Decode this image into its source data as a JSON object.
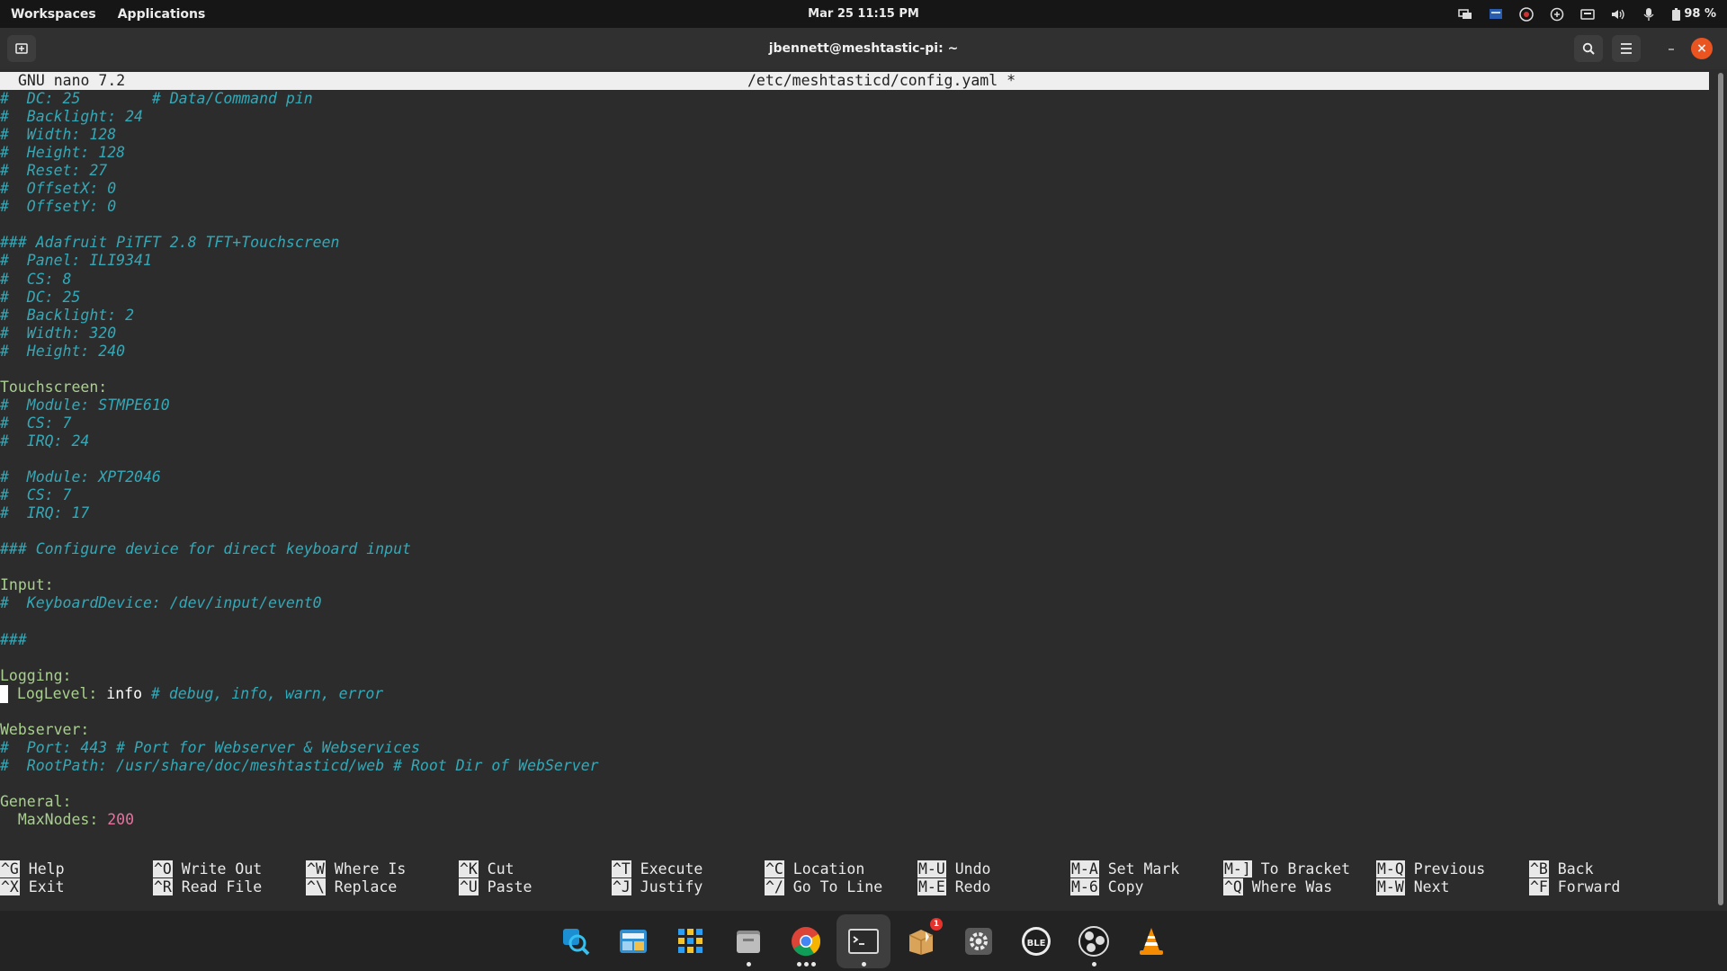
{
  "topbar": {
    "workspaces": "Workspaces",
    "applications": "Applications",
    "clock": "Mar 25  11:15 PM",
    "battery": "98 %"
  },
  "window": {
    "title": "jbennett@meshtastic-pi: ~",
    "new_tab_icon": "new-tab-icon",
    "search_icon": "search-icon",
    "menu_icon": "hamburger-menu-icon",
    "minimize_label": "–",
    "close_label": "×"
  },
  "nano": {
    "version": "GNU nano 7.2",
    "file": "/etc/meshtasticd/config.yaml *"
  },
  "editor_lines": [
    {
      "row": 0,
      "segs": [
        [
          "cm",
          "#  DC: 25        # Data/Command pin"
        ]
      ]
    },
    {
      "row": 1,
      "segs": [
        [
          "cm",
          "#  Backlight: 24"
        ]
      ]
    },
    {
      "row": 2,
      "segs": [
        [
          "cm",
          "#  Width: 128"
        ]
      ]
    },
    {
      "row": 3,
      "segs": [
        [
          "cm",
          "#  Height: 128"
        ]
      ]
    },
    {
      "row": 4,
      "segs": [
        [
          "cm",
          "#  Reset: 27"
        ]
      ]
    },
    {
      "row": 5,
      "segs": [
        [
          "cm",
          "#  OffsetX: 0"
        ]
      ]
    },
    {
      "row": 6,
      "segs": [
        [
          "cm",
          "#  OffsetY: 0"
        ]
      ]
    },
    {
      "row": 8,
      "segs": [
        [
          "cm",
          "### Adafruit PiTFT 2.8 TFT+Touchscreen"
        ]
      ]
    },
    {
      "row": 9,
      "segs": [
        [
          "cm",
          "#  Panel: ILI9341"
        ]
      ]
    },
    {
      "row": 10,
      "segs": [
        [
          "cm",
          "#  CS: 8"
        ]
      ]
    },
    {
      "row": 11,
      "segs": [
        [
          "cm",
          "#  DC: 25"
        ]
      ]
    },
    {
      "row": 12,
      "segs": [
        [
          "cm",
          "#  Backlight: 2"
        ]
      ]
    },
    {
      "row": 13,
      "segs": [
        [
          "cm",
          "#  Width: 320"
        ]
      ]
    },
    {
      "row": 14,
      "segs": [
        [
          "cm",
          "#  Height: 240"
        ]
      ]
    },
    {
      "row": 16,
      "segs": [
        [
          "ky",
          "Touchscreen:"
        ]
      ]
    },
    {
      "row": 17,
      "segs": [
        [
          "cm",
          "#  Module: STMPE610"
        ]
      ]
    },
    {
      "row": 18,
      "segs": [
        [
          "cm",
          "#  CS: 7"
        ]
      ]
    },
    {
      "row": 19,
      "segs": [
        [
          "cm",
          "#  IRQ: 24"
        ]
      ]
    },
    {
      "row": 21,
      "segs": [
        [
          "cm",
          "#  Module: XPT2046"
        ]
      ]
    },
    {
      "row": 22,
      "segs": [
        [
          "cm",
          "#  CS: 7"
        ]
      ]
    },
    {
      "row": 23,
      "segs": [
        [
          "cm",
          "#  IRQ: 17"
        ]
      ]
    },
    {
      "row": 25,
      "segs": [
        [
          "cm",
          "### Configure device for direct keyboard input"
        ]
      ]
    },
    {
      "row": 27,
      "segs": [
        [
          "ky",
          "Input:"
        ]
      ]
    },
    {
      "row": 28,
      "segs": [
        [
          "cm",
          "#  KeyboardDevice: /dev/input/event0"
        ]
      ]
    },
    {
      "row": 30,
      "segs": [
        [
          "cm",
          "###"
        ]
      ]
    },
    {
      "row": 32,
      "segs": [
        [
          "ky",
          "Logging:"
        ]
      ]
    },
    {
      "row": 33,
      "segs": [
        [
          "cursor",
          ""
        ],
        [
          "ky",
          " LogLevel: "
        ],
        [
          "tx",
          "info "
        ],
        [
          "cm",
          "# debug, info, warn, error"
        ]
      ]
    },
    {
      "row": 35,
      "segs": [
        [
          "ky",
          "Webserver:"
        ]
      ]
    },
    {
      "row": 36,
      "segs": [
        [
          "cm",
          "#  Port: 443 # Port for Webserver & Webservices"
        ]
      ]
    },
    {
      "row": 37,
      "segs": [
        [
          "cm",
          "#  RootPath: /usr/share/doc/meshtasticd/web # Root Dir of WebServer"
        ]
      ]
    },
    {
      "row": 39,
      "segs": [
        [
          "ky",
          "General:"
        ]
      ]
    },
    {
      "row": 40,
      "segs": [
        [
          "ky",
          "  MaxNodes: "
        ],
        [
          "nm",
          "200"
        ]
      ]
    }
  ],
  "shortcuts": [
    [
      {
        "key": "^G",
        "label": "Help"
      },
      {
        "key": "^X",
        "label": "Exit"
      }
    ],
    [
      {
        "key": "^O",
        "label": "Write Out"
      },
      {
        "key": "^R",
        "label": "Read File"
      }
    ],
    [
      {
        "key": "^W",
        "label": "Where Is"
      },
      {
        "key": "^\\",
        "label": "Replace"
      }
    ],
    [
      {
        "key": "^K",
        "label": "Cut"
      },
      {
        "key": "^U",
        "label": "Paste"
      }
    ],
    [
      {
        "key": "^T",
        "label": "Execute"
      },
      {
        "key": "^J",
        "label": "Justify"
      }
    ],
    [
      {
        "key": "^C",
        "label": "Location"
      },
      {
        "key": "^/",
        "label": "Go To Line"
      }
    ],
    [
      {
        "key": "M-U",
        "label": "Undo"
      },
      {
        "key": "M-E",
        "label": "Redo"
      }
    ],
    [
      {
        "key": "M-A",
        "label": "Set Mark"
      },
      {
        "key": "M-6",
        "label": "Copy"
      }
    ],
    [
      {
        "key": "M-]",
        "label": "To Bracket"
      },
      {
        "key": "^Q",
        "label": "Where Was"
      }
    ],
    [
      {
        "key": "M-Q",
        "label": "Previous"
      },
      {
        "key": "M-W",
        "label": "Next"
      }
    ],
    [
      {
        "key": "^B",
        "label": "Back"
      },
      {
        "key": "^F",
        "label": "Forward"
      }
    ]
  ],
  "dock": [
    {
      "name": "search-app-icon",
      "running": false
    },
    {
      "name": "system-monitor-icon",
      "running": false
    },
    {
      "name": "app-grid-icon",
      "running": false
    },
    {
      "name": "files-icon",
      "running": true
    },
    {
      "name": "chrome-icon",
      "running": true,
      "dots": 3
    },
    {
      "name": "terminal-icon",
      "running": true,
      "active": true
    },
    {
      "name": "software-updater-icon",
      "running": false,
      "badge": "1"
    },
    {
      "name": "settings-icon",
      "running": false
    },
    {
      "name": "ble-app-icon",
      "running": false
    },
    {
      "name": "obs-icon",
      "running": true
    },
    {
      "name": "vlc-icon",
      "running": false
    }
  ],
  "colors": {
    "comment": "#33a9b8",
    "key": "#a9d08e",
    "number": "#e6739f",
    "accent": "#e95420"
  }
}
